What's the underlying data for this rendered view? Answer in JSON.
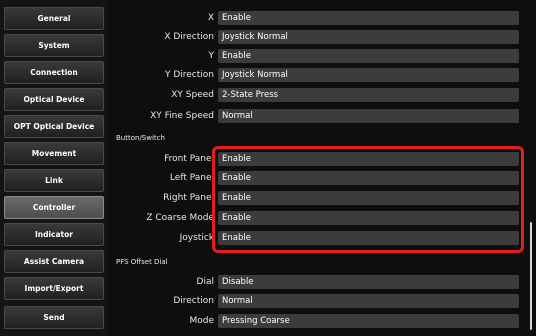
{
  "sidebar": {
    "items": [
      {
        "label": "General"
      },
      {
        "label": "System"
      },
      {
        "label": "Connection"
      },
      {
        "label": "Optical Device"
      },
      {
        "label": "OPT Optical Device"
      },
      {
        "label": "Movement"
      },
      {
        "label": "Link"
      },
      {
        "label": "Controller"
      },
      {
        "label": "Indicator"
      },
      {
        "label": "Assist Camera"
      },
      {
        "label": "Import/Export"
      }
    ],
    "active_item": "Controller",
    "send_label": "Send"
  },
  "main": {
    "rows_top": [
      {
        "label": "X",
        "value": "Enable"
      },
      {
        "label": "X Direction",
        "value": "Joystick Normal"
      },
      {
        "label": "Y",
        "value": "Enable"
      },
      {
        "label": "Y Direction",
        "value": "Joystick Normal"
      },
      {
        "label": "XY Speed",
        "value": "2-State Press"
      },
      {
        "label": "XY Fine Speed",
        "value": "Normal"
      }
    ],
    "button_switch": {
      "title": "Button/Switch",
      "rows": [
        {
          "label": "Front Panel",
          "value": "Enable"
        },
        {
          "label": "Left Panel",
          "value": "Enable"
        },
        {
          "label": "Right Panel",
          "value": "Enable"
        },
        {
          "label": "Z Coarse Mode",
          "value": "Enable"
        },
        {
          "label": "Joystick",
          "value": "Enable"
        }
      ]
    },
    "pfs_offset_dial": {
      "title": "PFS Offset Dial",
      "rows": [
        {
          "label": "Dial",
          "value": "Disable"
        },
        {
          "label": "Direction",
          "value": "Normal"
        },
        {
          "label": "Mode",
          "value": "Pressing Coarse"
        }
      ]
    }
  },
  "colors": {
    "highlight": "#e01e1e",
    "field_bg": "#3c3c3c",
    "active_tab": "#5a5a5a"
  }
}
